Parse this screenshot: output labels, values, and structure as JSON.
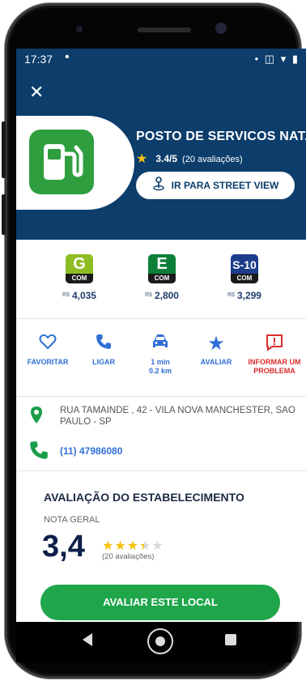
{
  "status_bar": {
    "time": "17:37",
    "dot": "•",
    "icons": "• ◫ ▾ ▮"
  },
  "header": {
    "close_icon": "✕",
    "station_name": "POSTO DE SERVICOS NATALI",
    "rating": "3.4/5",
    "rating_count": "(20 avaliações)",
    "street_view_label": "IR PARA STREET VIEW",
    "accent_color": "#0c3d6b"
  },
  "fuels": [
    {
      "letter": "G",
      "com": "COM",
      "currency": "R$",
      "price": "4,035",
      "color": "#8dbd22"
    },
    {
      "letter": "E",
      "com": "COM",
      "currency": "R$",
      "price": "2,800",
      "color": "#0d7f3a"
    },
    {
      "letter": "S-10",
      "com": "COM",
      "currency": "R$",
      "price": "3,299",
      "color": "#1c3c8c"
    }
  ],
  "actions": [
    {
      "icon": "heart-outline-icon",
      "label": "FAVORITAR"
    },
    {
      "icon": "phone-icon",
      "label": "LIGAR"
    },
    {
      "icon": "car-icon",
      "label": "1 min",
      "sub": "0.2 km"
    },
    {
      "icon": "star-icon",
      "label": "AVALIAR"
    },
    {
      "icon": "report-icon",
      "label": "INFORMAR UM",
      "sub": "PROBLEMA"
    }
  ],
  "address": {
    "text": "RUA TAMAINDE , 42 - VILA NOVA MANCHESTER, SAO PAULO - SP",
    "phone": "(11) 47986080"
  },
  "evaluation": {
    "title": "AVALIAÇÃO DO ESTABELECIMENTO",
    "subtitle": "NOTA GERAL",
    "score": "3,4",
    "stars": 3.4,
    "count": "(20 avaliações)",
    "button": "AVALIAR ESTE LOCAL"
  }
}
